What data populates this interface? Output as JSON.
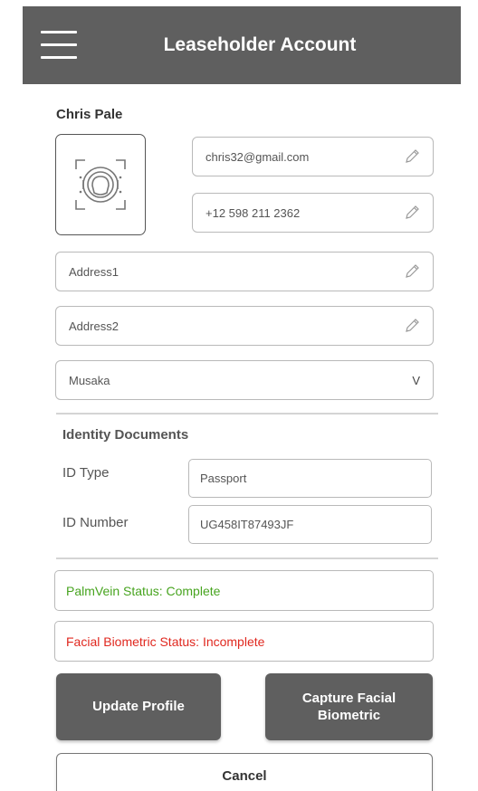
{
  "header": {
    "title": "Leaseholder Account",
    "menu_icon": "hamburger-menu-icon"
  },
  "profile": {
    "name": "Chris Pale",
    "face_icon": "face-scan-icon",
    "email": "chris32@gmail.com",
    "phone": "+12 598 211 2362",
    "address1_placeholder": "Address1",
    "address2_placeholder": "Address2",
    "city_selected": "Musaka",
    "dropdown_indicator": "V"
  },
  "identity": {
    "section_title": "Identity Documents",
    "id_type_label": "ID Type",
    "id_type_value": "Passport",
    "id_number_label": "ID Number",
    "id_number_value": "UG458IT87493JF"
  },
  "statuses": {
    "palmvein": "PalmVein Status: Complete",
    "palmvein_color": "#47a41f",
    "facial": "Facial Biometric Status: Incomplete",
    "facial_color": "#e0281f"
  },
  "actions": {
    "update_label": "Update Profile",
    "capture_line1": "Capture Facial",
    "capture_line2": "Biometric",
    "cancel_label": "Cancel"
  },
  "colors": {
    "header_bg": "#5f5f5f",
    "button_bg": "#5f5f5f"
  }
}
